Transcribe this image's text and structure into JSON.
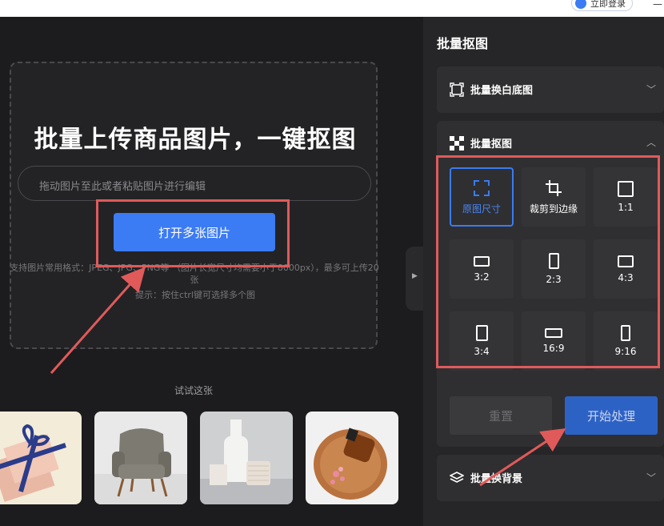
{
  "topbar": {
    "login_label": "立即登录",
    "minimize_glyph": "—"
  },
  "upload": {
    "headline": "批量上传商品图片，一键抠图",
    "paste_placeholder": "拖动图片至此或者粘贴图片进行编辑",
    "open_button": "打开多张图片",
    "format_hint": "支持图片常用格式：JPEG、JPG、PNG等 （图片长宽尺寸均需要小于8000px），最多可上传20张",
    "tip": "提示：按住ctrl键可选择多个图"
  },
  "samples": {
    "label": "试试这张",
    "items": [
      {
        "name": "gift-box"
      },
      {
        "name": "armchair"
      },
      {
        "name": "bottle-jar"
      },
      {
        "name": "cosmetic-tray"
      }
    ]
  },
  "panel": {
    "title": "批量抠图",
    "section_white_bg": {
      "label": "批量换白底图",
      "icon": "white-bg-icon",
      "chevron": "﹀"
    },
    "section_cutout": {
      "label": "批量抠图",
      "icon": "checker-icon",
      "chevron": "︿"
    },
    "sizes": [
      {
        "label": "原图尺寸",
        "icon": "fullscreen-icon",
        "selected": true
      },
      {
        "label": "裁剪到边缘",
        "icon": "crop-icon",
        "selected": false
      },
      {
        "label": "1:1",
        "icon": "ratio-1-1-icon",
        "selected": false
      },
      {
        "label": "3:2",
        "icon": "ratio-3-2-icon",
        "selected": false
      },
      {
        "label": "2:3",
        "icon": "ratio-2-3-icon",
        "selected": false
      },
      {
        "label": "4:3",
        "icon": "ratio-4-3-icon",
        "selected": false
      },
      {
        "label": "3:4",
        "icon": "ratio-3-4-icon",
        "selected": false
      },
      {
        "label": "16:9",
        "icon": "ratio-16-9-icon",
        "selected": false
      },
      {
        "label": "9:16",
        "icon": "ratio-9-16-icon",
        "selected": false
      }
    ],
    "reset_button": "重置",
    "start_button": "开始处理",
    "section_bg": {
      "label": "批量换背景",
      "icon": "layers-icon",
      "chevron": "﹀"
    }
  },
  "colors": {
    "accent": "#3b7bf3",
    "highlight": "#e05a5a",
    "panel": "#262628",
    "bg": "#1c1c1e"
  }
}
